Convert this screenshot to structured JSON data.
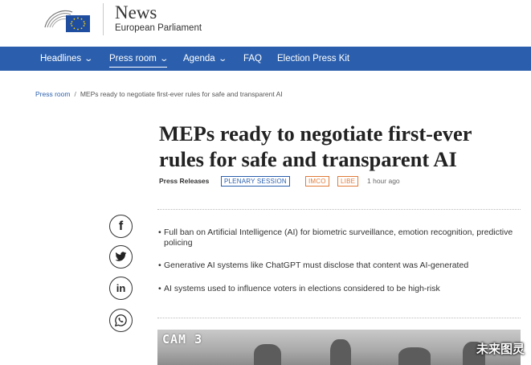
{
  "brand": {
    "title": "News",
    "subtitle": "European Parliament"
  },
  "nav": [
    {
      "label": "Headlines",
      "chevron": true
    },
    {
      "label": "Press room",
      "chevron": true,
      "active": true
    },
    {
      "label": "Agenda",
      "chevron": true
    },
    {
      "label": "FAQ",
      "chevron": false
    },
    {
      "label": "Election Press Kit",
      "chevron": false
    }
  ],
  "breadcrumb": {
    "parent": "Press room",
    "separator": "/",
    "current": "MEPs ready to negotiate first-ever rules for safe and transparent AI"
  },
  "article": {
    "headline": "MEPs ready to negotiate first-ever rules for safe and transparent AI",
    "category": "Press Releases",
    "tags": [
      "PLENARY SESSION",
      "IMCO",
      "LIBE"
    ],
    "time": "1 hour ago",
    "bullets": [
      "Full ban on Artificial Intelligence (AI) for biometric surveillance, emotion recognition, predictive policing",
      "Generative AI systems like ChatGPT must disclose that content was AI-generated",
      "AI systems used to influence voters in elections considered to be high-risk"
    ]
  },
  "share": {
    "facebook": "f",
    "twitter": "twitter-bird",
    "linkedin": "in",
    "whatsapp": "whatsapp-phone"
  },
  "photo": {
    "overlay_text": "CAM 3"
  },
  "watermark": "未来图灵",
  "colors": {
    "nav_bg": "#2b5fad",
    "tag_blue": "#2b5fad",
    "tag_orange": "#e07b39"
  }
}
